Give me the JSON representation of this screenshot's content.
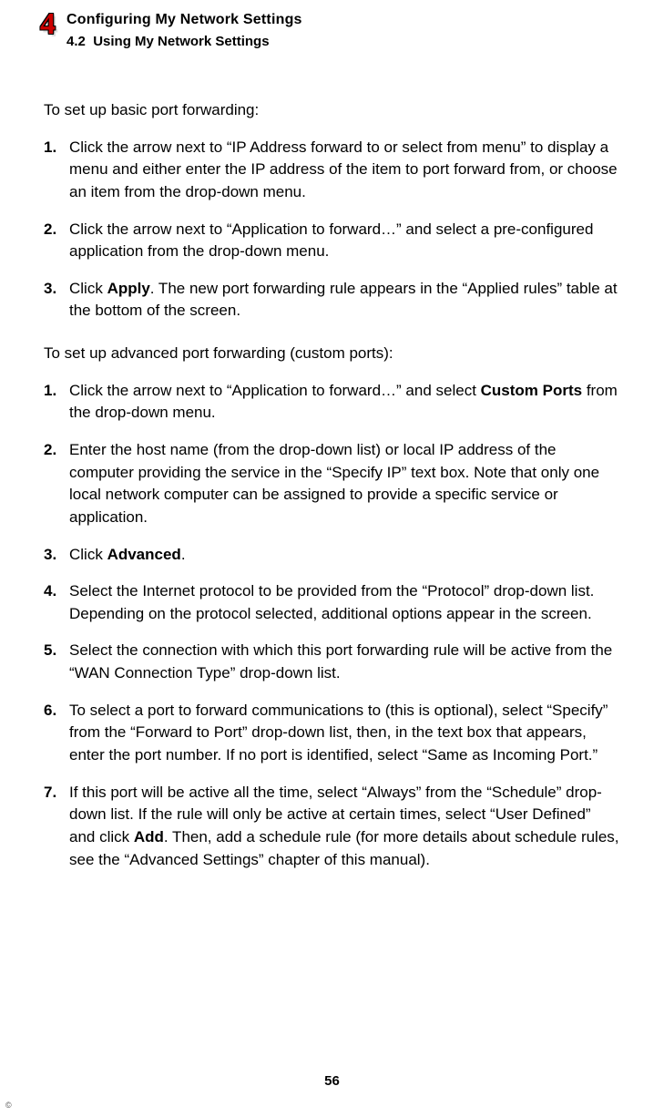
{
  "header": {
    "chapter_num": "4",
    "chapter_title": "Configuring My Network Settings",
    "section_num": "4.2",
    "section_title": "Using My Network Settings"
  },
  "basic": {
    "intro": "To set up basic port forwarding:",
    "steps": [
      {
        "n": "1.",
        "segs": [
          {
            "t": "Click the arrow next to “IP Address forward to or select from menu” to display a menu and either enter the IP address of the item to port forward from, or choose an item from the drop-down menu."
          }
        ]
      },
      {
        "n": "2.",
        "segs": [
          {
            "t": "Click the arrow next to “Application to forward…” and select a pre-configured application from the drop-down menu."
          }
        ]
      },
      {
        "n": "3.",
        "segs": [
          {
            "t": "Click "
          },
          {
            "t": "Apply",
            "b": true
          },
          {
            "t": ". The new port forwarding rule appears in the “Applied rules” table at the bottom of the screen."
          }
        ]
      }
    ]
  },
  "advanced": {
    "intro": "To set up advanced port forwarding (custom ports):",
    "steps": [
      {
        "n": "1.",
        "segs": [
          {
            "t": "Click the arrow next to “Application to forward…” and select "
          },
          {
            "t": "Custom Ports",
            "b": true
          },
          {
            "t": " from the drop-down menu."
          }
        ]
      },
      {
        "n": "2.",
        "segs": [
          {
            "t": "Enter the host name (from the drop-down list) or local IP address of the computer providing the service in the “Specify IP” text box. Note that only one local network computer can be assigned to provide a specific service or application."
          }
        ]
      },
      {
        "n": "3.",
        "segs": [
          {
            "t": "Click "
          },
          {
            "t": "Advanced",
            "b": true
          },
          {
            "t": "."
          }
        ]
      },
      {
        "n": "4.",
        "segs": [
          {
            "t": "Select the Internet protocol to be provided from the “Protocol” drop-down list.  Depending on the protocol selected, additional options appear in the screen."
          }
        ]
      },
      {
        "n": "5.",
        "segs": [
          {
            "t": "Select the connection with which this port forwarding rule will be active from the “WAN Connection Type” drop-down list."
          }
        ]
      },
      {
        "n": "6.",
        "segs": [
          {
            "t": "To select a port to forward communications to (this is optional), select “Specify” from the “Forward to Port” drop-down list, then, in the text box that appears, enter the port number. If no port is identified, select “Same as Incoming Port.”"
          }
        ]
      },
      {
        "n": "7.",
        "segs": [
          {
            "t": "If this port will be active all the time, select “Always” from the “Schedule” drop-down list. If the rule will only be active at certain times, select “User Defined” and click "
          },
          {
            "t": "Add",
            "b": true
          },
          {
            "t": ". Then, add a schedule rule (for more details about schedule rules, see the “Advanced Settings” chapter of this manual)."
          }
        ]
      }
    ]
  },
  "page_number": "56",
  "copyright": "©"
}
